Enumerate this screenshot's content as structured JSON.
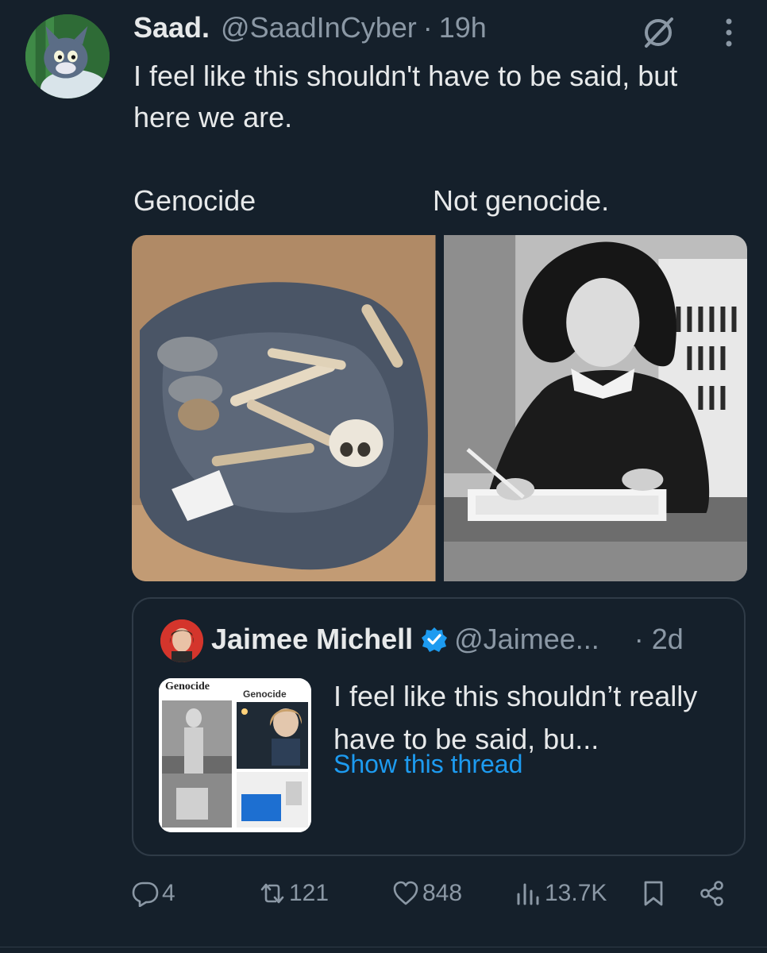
{
  "tweet": {
    "display_name": "Saad.",
    "handle": "@SaadInCyber",
    "separator": "·",
    "time": "19h",
    "text": "I feel like this shouldn't have to be said, but here we are.",
    "image_labels": {
      "left": "Genocide",
      "right": "Not genocide."
    }
  },
  "quote": {
    "display_name": "Jaimee Michell",
    "handle": "@Jaimee...",
    "time": "· 2d",
    "text": "I feel like this shouldn’t really have to be said, bu...",
    "link": "Show this thread",
    "thumb_labels": {
      "left": "Genocide",
      "right": "Genocide"
    }
  },
  "actions": {
    "replies": "4",
    "retweets": "121",
    "likes": "848",
    "views": "13.7K"
  },
  "icons": [
    "grok-icon",
    "more-icon",
    "verified-icon",
    "reply-icon",
    "retweet-icon",
    "like-icon",
    "views-icon",
    "bookmark-icon",
    "share-icon"
  ],
  "colors": {
    "background": "#15202b",
    "text": "#e7e9ea",
    "muted": "#8b98a5",
    "accent": "#1d9bf0",
    "border": "#2f3b47"
  }
}
